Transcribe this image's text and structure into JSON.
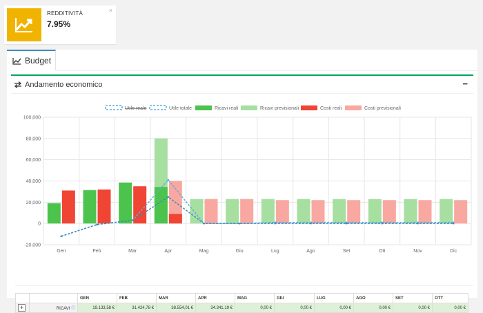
{
  "kpi": {
    "title": "REDDITIVITÀ",
    "value": "7.95%",
    "close": "×",
    "icon": "chart-line-icon",
    "color": "#f0b400"
  },
  "tab": {
    "label": "Budget",
    "icon": "line-chart-icon"
  },
  "panel": {
    "title": "Andamento economico",
    "icon": "exchange-icon",
    "collapse": "−"
  },
  "chart_data": {
    "type": "bar",
    "categories": [
      "Gen",
      "Feb",
      "Mar",
      "Apr",
      "Mag",
      "Giu",
      "Lug",
      "Ago",
      "Set",
      "Ott",
      "Nov",
      "Dic"
    ],
    "ylim": [
      -20000,
      100000
    ],
    "yticks": [
      "-20,000",
      "0",
      "20,000",
      "40,000",
      "60,000",
      "80,000",
      "100,000"
    ],
    "legend": [
      "Utile reale",
      "Utile totale",
      "Ricavi reali",
      "Ricavi previsionali",
      "Costi reali",
      "Costi previsionali"
    ],
    "legend_colors": [
      "#5dade2",
      "#5dade2",
      "#4cc34c",
      "#a6dfa0",
      "#f04434",
      "#f8a8a0"
    ],
    "ricavi_reali": [
      19134,
      31425,
      38554,
      34341,
      0,
      0,
      0,
      0,
      0,
      0,
      0,
      0
    ],
    "ricavi_previsionali": [
      0,
      0,
      0,
      80000,
      23000,
      23000,
      23000,
      23000,
      23000,
      23000,
      23000,
      23000
    ],
    "costi_reali": [
      31000,
      32000,
      35000,
      9000,
      0,
      0,
      0,
      0,
      0,
      0,
      0,
      0
    ],
    "costi_previsionali": [
      0,
      0,
      0,
      40000,
      23000,
      23000,
      22000,
      22000,
      22000,
      22000,
      22000,
      22000
    ],
    "utile_reale": [
      -12000,
      -1000,
      3000,
      25000,
      0,
      0,
      0,
      0,
      0,
      0,
      0,
      0
    ],
    "utile_totale": [
      -12000,
      -1000,
      3000,
      41000,
      0,
      0,
      1000,
      1000,
      1000,
      1000,
      1000,
      1000
    ]
  },
  "table": {
    "headers": [
      "GEN",
      "FEB",
      "MAR",
      "APR",
      "MAG",
      "GIU",
      "LUG",
      "AGO",
      "SET",
      "OTT"
    ],
    "row_label": "RICAVI",
    "values": [
      "19.133,58 €",
      "31.424,78 €",
      "38.554,01 €",
      "34.341,19 €",
      "0,00 €",
      "0,00 €",
      "0,00 €",
      "0,00 €",
      "0,00 €",
      "0,00 €"
    ]
  }
}
